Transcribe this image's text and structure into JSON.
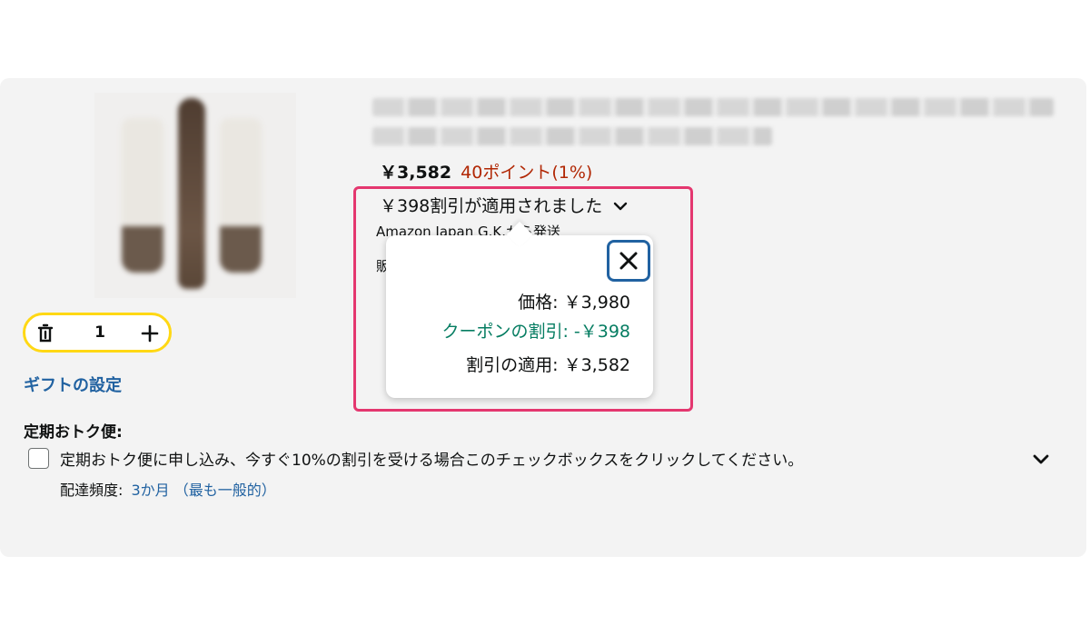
{
  "product": {
    "price": "￥3,582",
    "points": "40ポイント(1%)",
    "discount_applied": "￥398割引が適用されました",
    "ship_from": "Amazon Japan G.K.から発送",
    "sold_by": "販"
  },
  "popover": {
    "price_row": "価格: ￥3,980",
    "coupon_row": "クーポンの割引: -￥398",
    "applied_row": "割引の適用: ￥3,582"
  },
  "cart": {
    "quantity": "1",
    "gift_link": "ギフトの設定"
  },
  "subscribe": {
    "heading": "定期おトク便:",
    "checkbox_label": "定期おトク便に申し込み、今すぐ10%の割引を受ける場合このチェックボックスをクリックしてください。",
    "frequency_label": "配達頻度:",
    "frequency_value": "3か月 （最も一般的）",
    "checked": false
  },
  "colors": {
    "highlight_border": "#e4376f",
    "stepper_border": "#ffd814",
    "link_blue": "#2162a1",
    "coupon_green": "#067d62",
    "points_red": "#b12704"
  },
  "icons": {
    "close": "close-icon",
    "trash": "trash-icon",
    "plus": "plus-icon",
    "chevron": "chevron-down-icon"
  }
}
